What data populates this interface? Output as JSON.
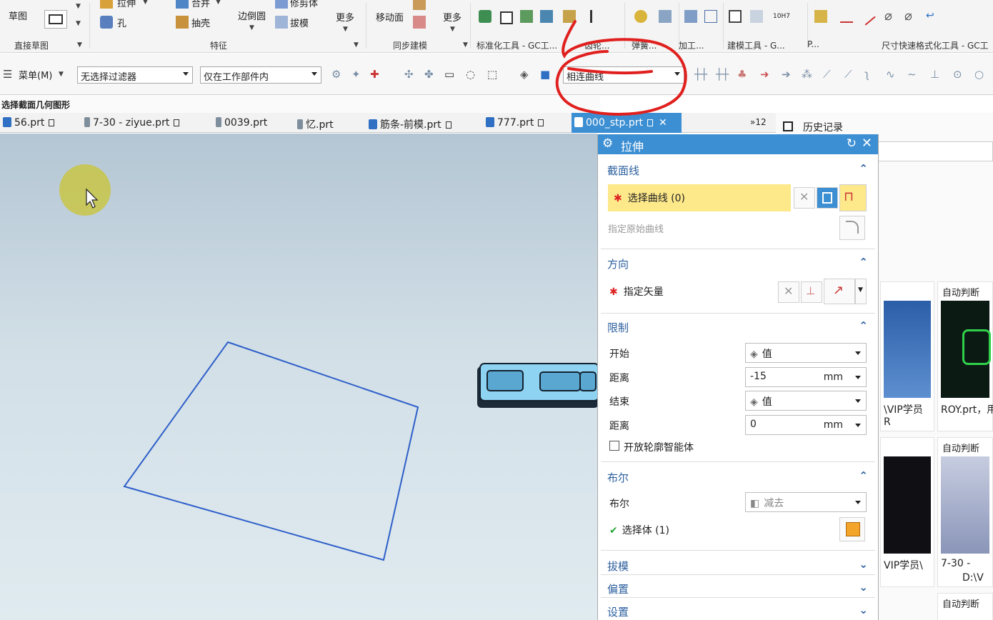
{
  "ribbon": {
    "sketch": "草图",
    "extrude": "拉伸",
    "hole": "孔",
    "unite": "合并",
    "shell": "抽壳",
    "edge_blend": "边倒圆",
    "trim_body": "修剪体",
    "draft": "拔模",
    "more1": "更多",
    "move_face": "移动面",
    "more2": "更多",
    "hole_label": "10H7",
    "groups": {
      "direct_sketch": "直接草图",
      "feature": "特征",
      "sync_model": "同步建模",
      "std_tools": "标准化工具 - GC工...",
      "gear": "齿轮...",
      "spring": "弹簧...",
      "machining": "加工...",
      "modeling_tools": "建模工具 - G...",
      "more_p": "P...",
      "dim_format": "尺寸快速格式化工具 - GC工"
    }
  },
  "toolbar": {
    "menu": "菜单(M)",
    "filter": "无选择过滤器",
    "scope": "仅在工作部件内",
    "curve_rule": "相连曲线"
  },
  "status": "选择截面几何图形",
  "tabs": [
    {
      "label": "56.prt"
    },
    {
      "label": "7-30 - ziyue.prt"
    },
    {
      "label": "0039.prt"
    },
    {
      "label": "忆.prt"
    },
    {
      "label": "筋条-前模.prt"
    },
    {
      "label": "777.prt"
    },
    {
      "label": "000_stp.prt"
    }
  ],
  "tab_overflow": "»12",
  "history": "历史记录",
  "dialog": {
    "title": "拉伸",
    "section_curve": {
      "header": "截面线",
      "select_curve": "选择曲线 (0)",
      "specify_origin": "指定原始曲线"
    },
    "direction": {
      "header": "方向",
      "specify_vector": "指定矢量"
    },
    "limits": {
      "header": "限制",
      "start_label": "开始",
      "start_value": "值",
      "start_dist_label": "距离",
      "start_dist": "-15",
      "end_label": "结束",
      "end_value": "值",
      "end_dist_label": "距离",
      "end_dist": "0",
      "unit": "mm",
      "open_profile": "开放轮廓智能体"
    },
    "boolean": {
      "header": "布尔",
      "label": "布尔",
      "value": "减去",
      "select_body": "选择体 (1)"
    },
    "draft_header": "拔模",
    "offset_header": "偏置",
    "settings_header": "设置"
  },
  "thumbs": [
    {
      "label": "",
      "caption": "\\VIP学员"
    },
    {
      "label": "自动判断",
      "caption": "ROY.prt，用"
    },
    {
      "label": "",
      "caption": "VIP学员\\"
    },
    {
      "label": "自动判断",
      "caption": "7-30 -"
    },
    {
      "label": "自动判断",
      "caption": ""
    }
  ],
  "thumb_extra": {
    "r_letter": "R",
    "dv": "D:\\V"
  },
  "colors": {
    "accent": "#3d8fd3",
    "highlight": "#fde88a",
    "sketch_line": "#2e5fc9",
    "annotation": "#e0201e"
  }
}
